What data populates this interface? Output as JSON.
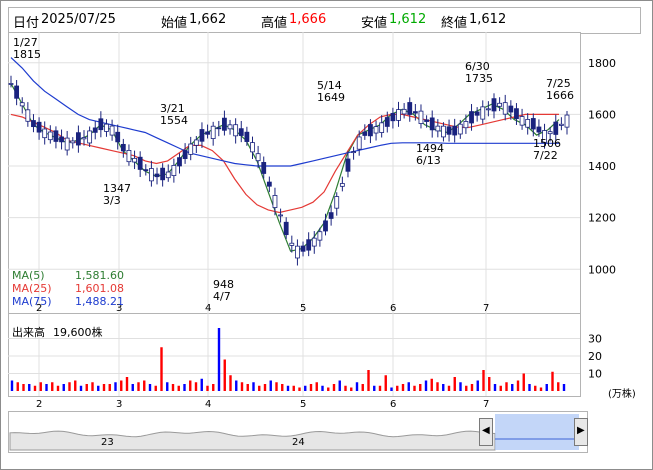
{
  "header": {
    "date_label": "日付",
    "date_value": "2025/07/25",
    "open_label": "始値",
    "open_value": "1,662",
    "high_label": "高値",
    "high_value": "1,666",
    "low_label": "安値",
    "low_value": "1,612",
    "close_label": "終値",
    "close_value": "1,612",
    "colors": {
      "high": "#ff0000",
      "low": "#00aa00"
    }
  },
  "main_chart": {
    "y_ticks": [
      "1800",
      "1600",
      "1400",
      "1200",
      "1000"
    ],
    "x_ticks": [
      "2",
      "3",
      "4",
      "5",
      "6",
      "7"
    ],
    "annotations": [
      {
        "date": "1/27",
        "value": "1815"
      },
      {
        "date": "3/21",
        "value": "1554"
      },
      {
        "date": "5/14",
        "value": "1649"
      },
      {
        "date": "6/30",
        "value": "1735"
      },
      {
        "date": "7/25",
        "value": "1666"
      },
      {
        "value": "1347",
        "date": "3/3"
      },
      {
        "value": "948",
        "date": "4/7"
      },
      {
        "value": "1494",
        "date": "6/13"
      },
      {
        "value": "1506",
        "date": "7/22"
      }
    ],
    "ma_legend": [
      {
        "label": "MA(5)",
        "value": "1,581.60",
        "color": "#2e7d32"
      },
      {
        "label": "MA(25)",
        "value": "1,601.08",
        "color": "#e53935"
      },
      {
        "label": "MA(75)",
        "value": "1,488.21",
        "color": "#1e3ccf"
      }
    ]
  },
  "volume_chart": {
    "label": "出来高",
    "value": "19,600株",
    "y_ticks": [
      "30",
      "20",
      "10"
    ],
    "unit": "(万株)",
    "x_ticks": [
      "2",
      "3",
      "4",
      "5",
      "6",
      "7"
    ]
  },
  "navigator": {
    "labels": [
      "23",
      "24"
    ],
    "left_handle_icon": "chevron-left-icon",
    "right_handle_icon": "chevron-right-icon"
  },
  "chart_data": {
    "type": "candlestick",
    "ylim": [
      850,
      1900
    ],
    "series": [
      {
        "name": "MA(5)",
        "color": "#2e7d32",
        "values": [
          1720,
          1640,
          1560,
          1530,
          1510,
          1490,
          1500,
          1520,
          1560,
          1540,
          1460,
          1420,
          1380,
          1360,
          1370,
          1420,
          1480,
          1520,
          1540,
          1560,
          1540,
          1500,
          1420,
          1300,
          1180,
          1070,
          1080,
          1120,
          1180,
          1300,
          1440,
          1520,
          1540,
          1560,
          1600,
          1620,
          1600,
          1560,
          1540,
          1530,
          1560,
          1600,
          1620,
          1640,
          1620,
          1580,
          1560,
          1520,
          1540,
          1580
        ]
      },
      {
        "name": "MA(25)",
        "color": "#e53935",
        "values": [
          1600,
          1590,
          1570,
          1550,
          1530,
          1500,
          1490,
          1480,
          1470,
          1460,
          1450,
          1440,
          1420,
          1410,
          1420,
          1450,
          1480,
          1480,
          1460,
          1420,
          1350,
          1290,
          1250,
          1230,
          1220,
          1230,
          1240,
          1260,
          1300,
          1380,
          1450,
          1520,
          1560,
          1590,
          1600,
          1600,
          1590,
          1580,
          1570,
          1560,
          1550,
          1550,
          1560,
          1570,
          1580,
          1590,
          1600,
          1600,
          1600,
          1600
        ]
      },
      {
        "name": "MA(75)",
        "color": "#1e3ccf",
        "values": [
          1820,
          1780,
          1730,
          1690,
          1660,
          1630,
          1600,
          1580,
          1570,
          1560,
          1550,
          1540,
          1530,
          1510,
          1490,
          1470,
          1450,
          1440,
          1430,
          1420,
          1410,
          1405,
          1400,
          1400,
          1400,
          1400,
          1410,
          1420,
          1430,
          1440,
          1450,
          1460,
          1470,
          1480,
          1488,
          1490,
          1490,
          1490,
          1490,
          1488,
          1488,
          1488,
          1488,
          1488,
          1488,
          1488,
          1488,
          1488,
          1488,
          1488
        ]
      }
    ],
    "volume": [
      6,
      5,
      4,
      4,
      3,
      5,
      4,
      5,
      3,
      4,
      5,
      6,
      3,
      4,
      5,
      3,
      4,
      4,
      5,
      6,
      8,
      4,
      5,
      6,
      4,
      3,
      25,
      5,
      4,
      3,
      4,
      6,
      5,
      7,
      3,
      4,
      36,
      18,
      9,
      6,
      5,
      4,
      5,
      3,
      4,
      6,
      5,
      4,
      3,
      3,
      2,
      3,
      4,
      5,
      3,
      2,
      4,
      6,
      3,
      2,
      5,
      4,
      12,
      3,
      3,
      9,
      2,
      3,
      4,
      5,
      3,
      4,
      6,
      7,
      5,
      4,
      3,
      8,
      5,
      3,
      4,
      6,
      12,
      8,
      4,
      3,
      5,
      4,
      6,
      10,
      4,
      3,
      2,
      4,
      11,
      5,
      4
    ],
    "volume_colors_up": "#ff0000",
    "volume_colors_down": "#0000ff"
  }
}
